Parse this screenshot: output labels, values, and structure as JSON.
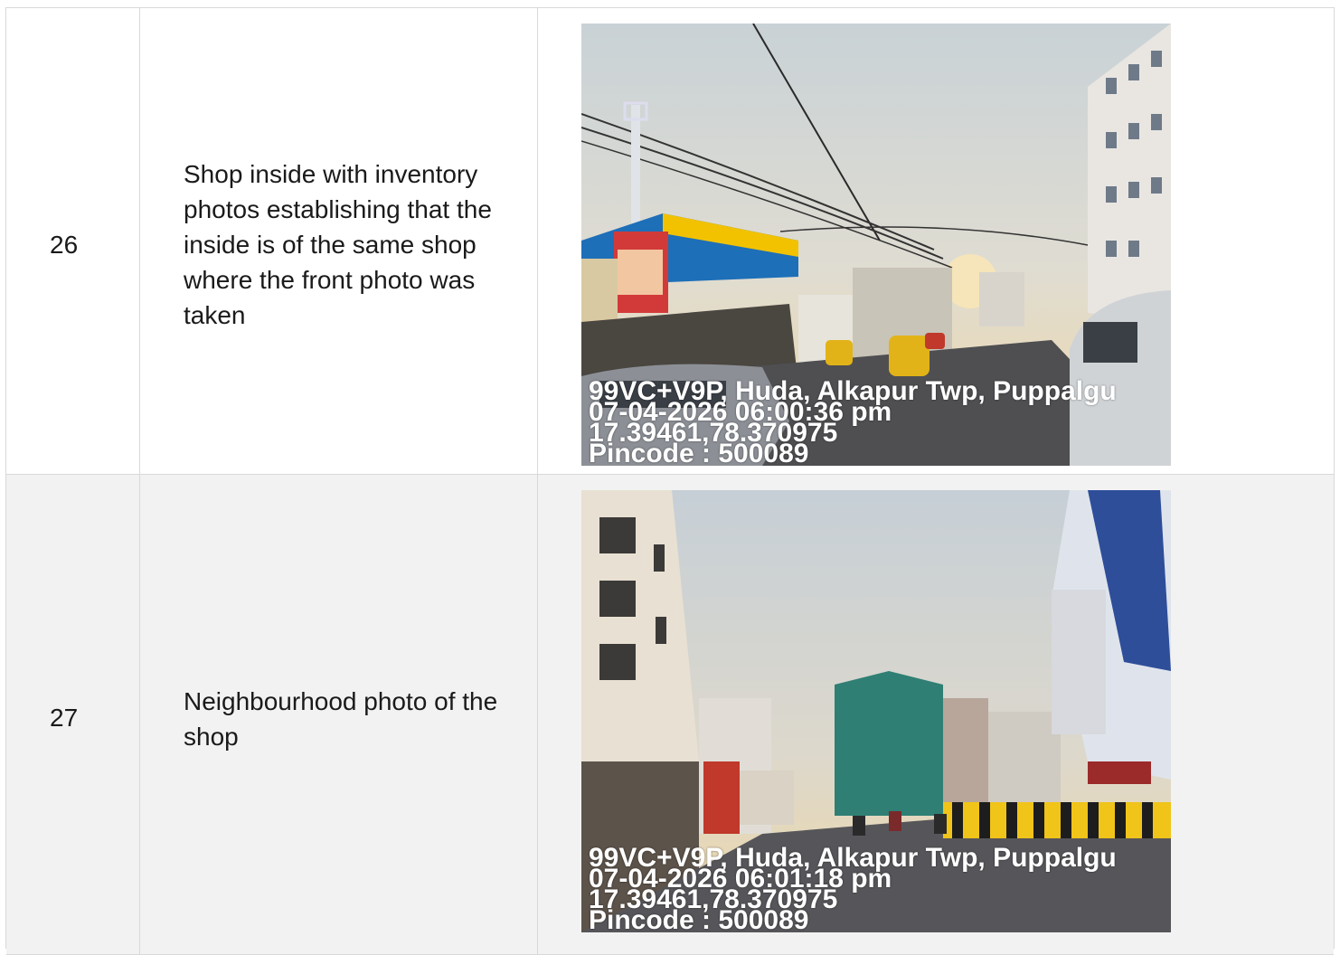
{
  "rows": [
    {
      "number": "26",
      "description": "Shop inside with inventory photos establishing that the inside is of the same shop where the front photo was taken",
      "photo": {
        "icon": "street-photo-fuel-station",
        "stamp": {
          "address": "99VC+V9P, Huda, Alkapur Twp, Puppalgu",
          "datetime": "07-04-2026 06:00:36 pm",
          "coords": "17.39461,78.370975",
          "pincode": "Pincode : 500089"
        }
      }
    },
    {
      "number": "27",
      "description": "Neighbourhood photo of the shop",
      "photo": {
        "icon": "street-photo-neighbourhood",
        "stamp": {
          "address": "99VC+V9P, Huda, Alkapur Twp, Puppalgu",
          "datetime": "07-04-2026 06:01:18 pm",
          "coords": "17.39461,78.370975",
          "pincode": "Pincode : 500089"
        }
      }
    }
  ]
}
